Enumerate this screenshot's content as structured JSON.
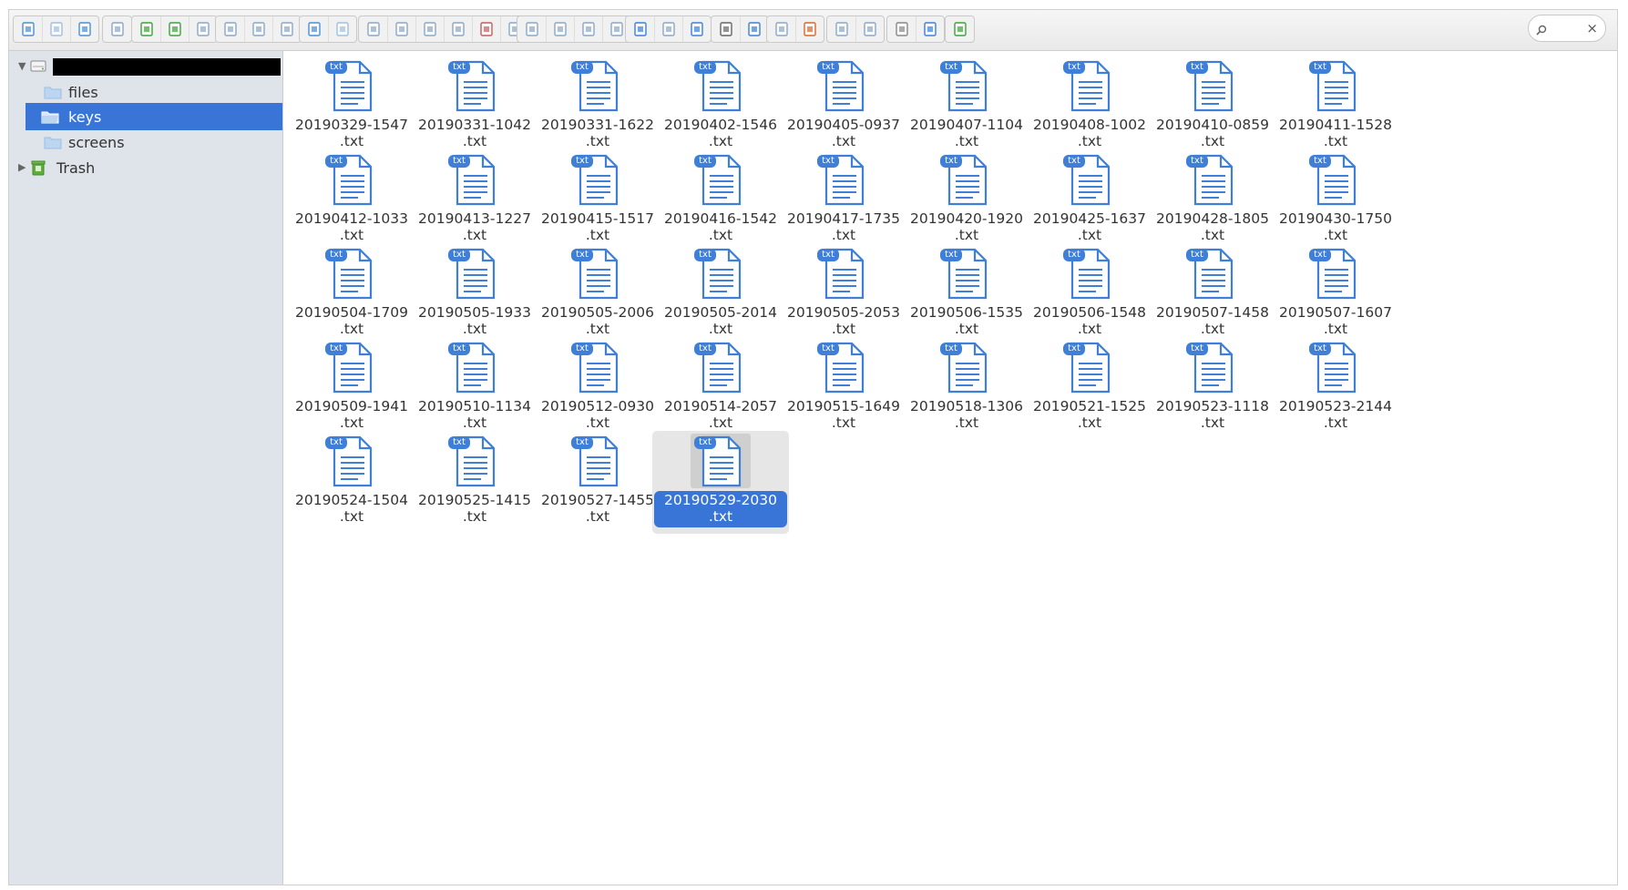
{
  "toolbar": {
    "groups": [
      [
        "back-icon",
        "forward-icon",
        "up-icon"
      ],
      [
        "network-drive-icon"
      ],
      [
        "download-icon",
        "new-file-icon",
        "save-icon"
      ],
      [
        "open-book-icon",
        "save-as-icon",
        "select-icon"
      ],
      [
        "undo-icon",
        "redo-icon"
      ],
      [
        "copy-icon",
        "cut-icon",
        "paste-icon",
        "duplicate-icon",
        "delete-icon",
        "resize-icon"
      ],
      [
        "rename-icon",
        "select-all-icon",
        "edit-icon",
        "upload-icon"
      ],
      [
        "view-icons-icon",
        "view-small-icons-icon",
        "view-tiles-icon"
      ],
      [
        "preview-eye-icon",
        "info-icon"
      ],
      [
        "extract-icon",
        "archive-icon"
      ],
      [
        "view-list-icon",
        "compare-icon"
      ],
      [
        "settings-gear-icon",
        "help-icon"
      ],
      [
        "fullscreen-icon"
      ]
    ],
    "search": {
      "placeholder": "",
      "clear": "×"
    }
  },
  "sidebar": {
    "root": {
      "label": ""
    },
    "items": [
      {
        "label": "files",
        "icon": "folder-icon",
        "selected": false
      },
      {
        "label": "keys",
        "icon": "folder-open-icon",
        "selected": true
      },
      {
        "label": "screens",
        "icon": "folder-icon",
        "selected": false
      }
    ],
    "trash": {
      "label": "Trash",
      "icon": "trash-icon"
    }
  },
  "files": [
    {
      "name": "20190329-1547\n.txt",
      "badge": "txt",
      "selected": false
    },
    {
      "name": "20190331-1042\n.txt",
      "badge": "txt",
      "selected": false
    },
    {
      "name": "20190331-1622\n.txt",
      "badge": "txt",
      "selected": false
    },
    {
      "name": "20190402-1546\n.txt",
      "badge": "txt",
      "selected": false
    },
    {
      "name": "20190405-0937\n.txt",
      "badge": "txt",
      "selected": false
    },
    {
      "name": "20190407-1104\n.txt",
      "badge": "txt",
      "selected": false
    },
    {
      "name": "20190408-1002\n.txt",
      "badge": "txt",
      "selected": false
    },
    {
      "name": "20190410-0859\n.txt",
      "badge": "txt",
      "selected": false
    },
    {
      "name": "20190411-1528\n.txt",
      "badge": "txt",
      "selected": false
    },
    {
      "name": "20190412-1033\n.txt",
      "badge": "txt",
      "selected": false
    },
    {
      "name": "20190413-1227\n.txt",
      "badge": "txt",
      "selected": false
    },
    {
      "name": "20190415-1517\n.txt",
      "badge": "txt",
      "selected": false
    },
    {
      "name": "20190416-1542\n.txt",
      "badge": "txt",
      "selected": false
    },
    {
      "name": "20190417-1735\n.txt",
      "badge": "txt",
      "selected": false
    },
    {
      "name": "20190420-1920\n.txt",
      "badge": "txt",
      "selected": false
    },
    {
      "name": "20190425-1637\n.txt",
      "badge": "txt",
      "selected": false
    },
    {
      "name": "20190428-1805\n.txt",
      "badge": "txt",
      "selected": false
    },
    {
      "name": "20190430-1750\n.txt",
      "badge": "txt",
      "selected": false
    },
    {
      "name": "20190504-1709\n.txt",
      "badge": "txt",
      "selected": false
    },
    {
      "name": "20190505-1933\n.txt",
      "badge": "txt",
      "selected": false
    },
    {
      "name": "20190505-2006\n.txt",
      "badge": "txt",
      "selected": false
    },
    {
      "name": "20190505-2014\n.txt",
      "badge": "txt",
      "selected": false
    },
    {
      "name": "20190505-2053\n.txt",
      "badge": "txt",
      "selected": false
    },
    {
      "name": "20190506-1535\n.txt",
      "badge": "txt",
      "selected": false
    },
    {
      "name": "20190506-1548\n.txt",
      "badge": "txt",
      "selected": false
    },
    {
      "name": "20190507-1458\n.txt",
      "badge": "txt",
      "selected": false
    },
    {
      "name": "20190507-1607\n.txt",
      "badge": "txt",
      "selected": false
    },
    {
      "name": "20190509-1941\n.txt",
      "badge": "txt",
      "selected": false
    },
    {
      "name": "20190510-1134\n.txt",
      "badge": "txt",
      "selected": false
    },
    {
      "name": "20190512-0930\n.txt",
      "badge": "txt",
      "selected": false
    },
    {
      "name": "20190514-2057\n.txt",
      "badge": "txt",
      "selected": false
    },
    {
      "name": "20190515-1649\n.txt",
      "badge": "txt",
      "selected": false
    },
    {
      "name": "20190518-1306\n.txt",
      "badge": "txt",
      "selected": false
    },
    {
      "name": "20190521-1525\n.txt",
      "badge": "txt",
      "selected": false
    },
    {
      "name": "20190523-1118\n.txt",
      "badge": "txt",
      "selected": false
    },
    {
      "name": "20190523-2144\n.txt",
      "badge": "txt",
      "selected": false
    },
    {
      "name": "20190524-1504\n.txt",
      "badge": "txt",
      "selected": false
    },
    {
      "name": "20190525-1415\n.txt",
      "badge": "txt",
      "selected": false
    },
    {
      "name": "20190527-1455\n.txt",
      "badge": "txt",
      "selected": false
    },
    {
      "name": "20190529-2030\n.txt",
      "badge": "txt",
      "selected": true
    }
  ],
  "colors": {
    "accent": "#3875d7",
    "sidebar_bg": "#dfe4ea",
    "icon_blue": "#3f7fd8"
  }
}
